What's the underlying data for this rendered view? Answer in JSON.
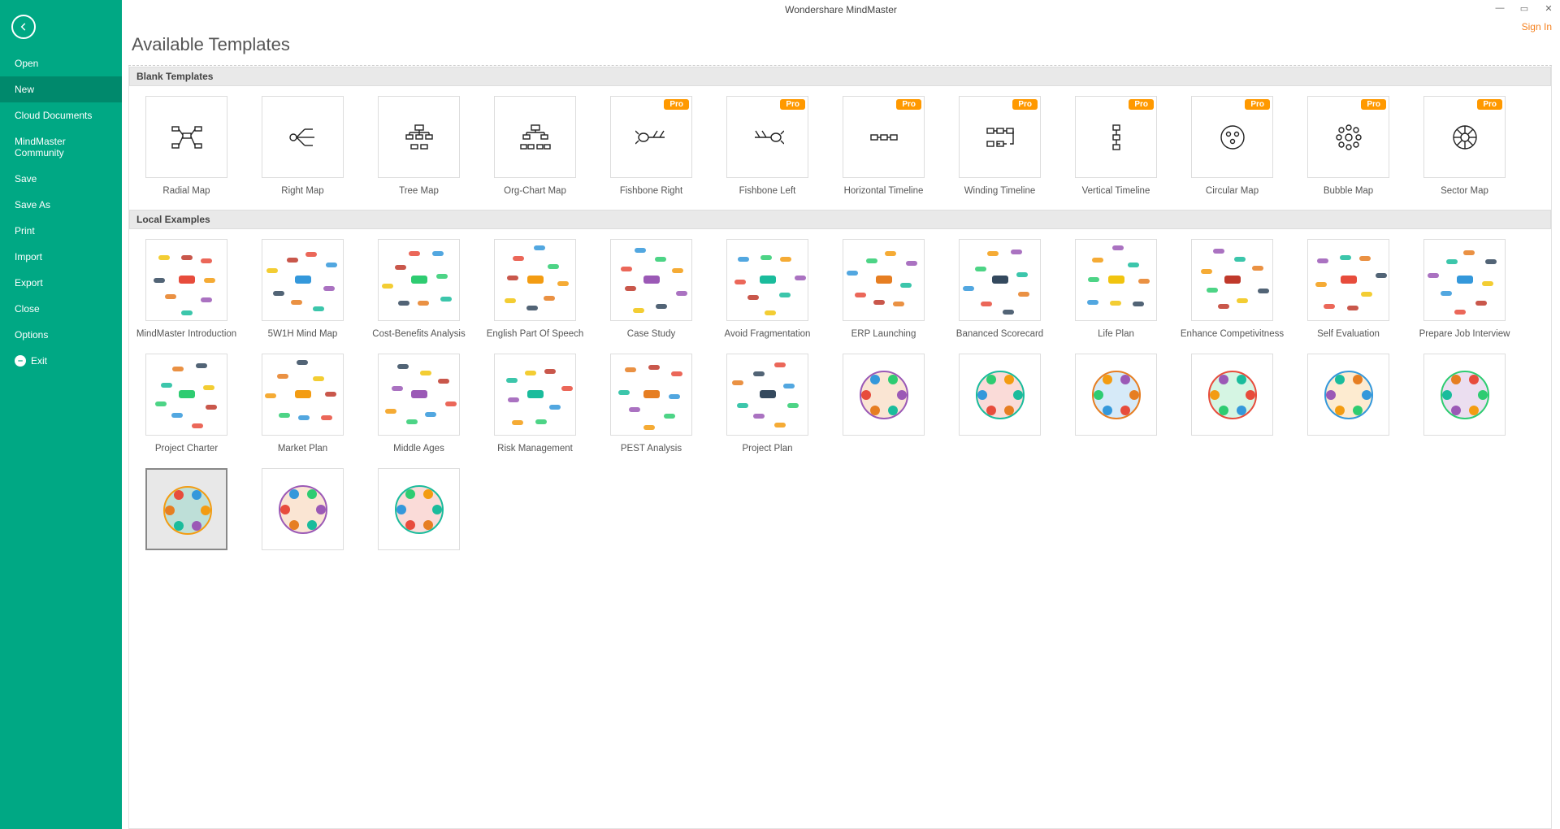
{
  "app_title": "Wondershare MindMaster",
  "signin": "Sign In",
  "page_title": "Available Templates",
  "pro_label": "Pro",
  "sidebar": {
    "items": [
      {
        "label": "Open",
        "key": "open"
      },
      {
        "label": "New",
        "key": "new",
        "active": true
      },
      {
        "label": "Cloud Documents",
        "key": "cloud"
      },
      {
        "label": "MindMaster Community",
        "key": "community"
      },
      {
        "label": "Save",
        "key": "save"
      },
      {
        "label": "Save As",
        "key": "saveas"
      },
      {
        "label": "Print",
        "key": "print"
      },
      {
        "label": "Import",
        "key": "import"
      },
      {
        "label": "Export",
        "key": "export"
      },
      {
        "label": "Close",
        "key": "close"
      },
      {
        "label": "Options",
        "key": "options"
      }
    ],
    "exit": "Exit"
  },
  "sections": {
    "blank": "Blank Templates",
    "local": "Local Examples"
  },
  "blank_templates": [
    {
      "label": "Radial Map",
      "icon": "radial",
      "pro": false
    },
    {
      "label": "Right Map",
      "icon": "right",
      "pro": false
    },
    {
      "label": "Tree Map",
      "icon": "tree",
      "pro": false
    },
    {
      "label": "Org-Chart Map",
      "icon": "org",
      "pro": false
    },
    {
      "label": "Fishbone Right",
      "icon": "fishr",
      "pro": true
    },
    {
      "label": "Fishbone Left",
      "icon": "fishl",
      "pro": true
    },
    {
      "label": "Horizontal Timeline",
      "icon": "htime",
      "pro": true
    },
    {
      "label": "Winding Timeline",
      "icon": "wtime",
      "pro": true
    },
    {
      "label": "Vertical Timeline",
      "icon": "vtime",
      "pro": true
    },
    {
      "label": "Circular Map",
      "icon": "circ",
      "pro": true
    },
    {
      "label": "Bubble Map",
      "icon": "bubble",
      "pro": true
    },
    {
      "label": "Sector Map",
      "icon": "sector",
      "pro": true
    }
  ],
  "local_examples": [
    {
      "label": "MindMaster Introduction"
    },
    {
      "label": "5W1H Mind Map"
    },
    {
      "label": "Cost-Benefits Analysis"
    },
    {
      "label": "English Part Of Speech"
    },
    {
      "label": "Case Study"
    },
    {
      "label": "Avoid Fragmentation"
    },
    {
      "label": "ERP Launching"
    },
    {
      "label": "Bananced Scorecard"
    },
    {
      "label": "Life Plan"
    },
    {
      "label": "Enhance Competivitness"
    },
    {
      "label": "Self Evaluation"
    },
    {
      "label": "Prepare Job Interview"
    },
    {
      "label": "Project Charter"
    },
    {
      "label": "Market Plan"
    },
    {
      "label": "Middle Ages"
    },
    {
      "label": "Risk Management"
    },
    {
      "label": "PEST Analysis"
    },
    {
      "label": "Project Plan"
    },
    {
      "label": ""
    },
    {
      "label": ""
    },
    {
      "label": ""
    },
    {
      "label": ""
    },
    {
      "label": ""
    },
    {
      "label": ""
    },
    {
      "label": "",
      "selected": true
    },
    {
      "label": ""
    },
    {
      "label": ""
    }
  ],
  "colors": {
    "sidebar": "#00a884",
    "pro": "#ff9900",
    "signin": "#f58220"
  }
}
